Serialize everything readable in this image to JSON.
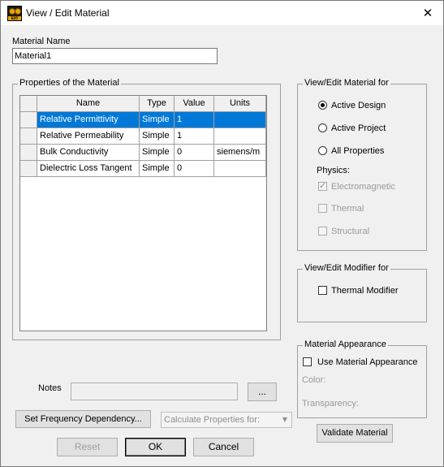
{
  "window": {
    "title": "View / Edit Material",
    "close_glyph": "✕",
    "icon_text": "EDT"
  },
  "material_name": {
    "label": "Material Name",
    "value": "Material1"
  },
  "properties": {
    "group_title": "Properties of the Material",
    "columns": [
      "Name",
      "Type",
      "Value",
      "Units"
    ],
    "rows": [
      {
        "name": "Relative Permittivity",
        "type": "Simple",
        "value": "1",
        "units": ""
      },
      {
        "name": "Relative Permeability",
        "type": "Simple",
        "value": "1",
        "units": ""
      },
      {
        "name": "Bulk Conductivity",
        "type": "Simple",
        "value": "0",
        "units": "siemens/m"
      },
      {
        "name": "Dielectric Loss Tangent",
        "type": "Simple",
        "value": "0",
        "units": ""
      }
    ]
  },
  "view_edit_for": {
    "group_title": "View/Edit Material for",
    "options": [
      "Active Design",
      "Active Project",
      "All Properties"
    ],
    "selected": "Active Design",
    "physics_label": "Physics:",
    "physics": [
      {
        "label": "Electromagnetic",
        "checked": true
      },
      {
        "label": "Thermal",
        "checked": false
      },
      {
        "label": "Structural",
        "checked": false
      }
    ]
  },
  "modifier": {
    "group_title": "View/Edit Modifier for",
    "thermal_label": "Thermal Modifier"
  },
  "appearance": {
    "group_title": "Material Appearance",
    "use_label": "Use Material Appearance",
    "color_label": "Color:",
    "transparency_label": "Transparency:"
  },
  "notes": {
    "label": "Notes",
    "value": "",
    "browse_label": "..."
  },
  "buttons": {
    "set_freq": "Set Frequency Dependency...",
    "calc_props": "Calculate Properties for:",
    "validate": "Validate Material",
    "reset": "Reset",
    "ok": "OK",
    "cancel": "Cancel"
  },
  "icons": {
    "combo_arrow": "▼",
    "check_mark": "✓"
  }
}
